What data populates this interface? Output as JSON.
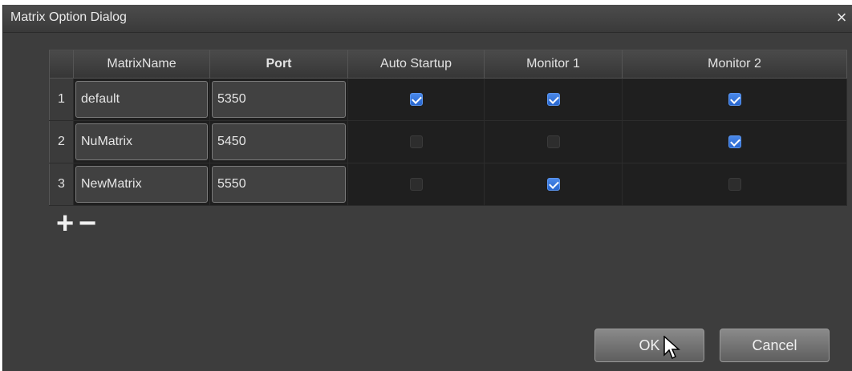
{
  "dialog": {
    "title": "Matrix Option Dialog",
    "close_glyph": "×"
  },
  "table": {
    "headers": [
      "MatrixName",
      "Port",
      "Auto Startup",
      "Monitor 1",
      "Monitor 2"
    ],
    "rows": [
      {
        "num": "1",
        "name": "default",
        "port": "5350",
        "auto_startup": true,
        "monitor1": true,
        "monitor2": true
      },
      {
        "num": "2",
        "name": "NuMatrix",
        "port": "5450",
        "auto_startup": false,
        "monitor1": false,
        "monitor2": true
      },
      {
        "num": "3",
        "name": "NewMatrix",
        "port": "5550",
        "auto_startup": false,
        "monitor1": true,
        "monitor2": false
      }
    ]
  },
  "controls": {
    "add_glyph": "+",
    "remove_glyph": "−"
  },
  "buttons": {
    "ok": "OK",
    "cancel": "Cancel"
  },
  "icons": {
    "close": "close-icon",
    "add": "plus-icon",
    "remove": "minus-icon",
    "cursor": "mouse-pointer-icon"
  },
  "colors": {
    "checkbox_on": "#2f6fd8",
    "background": "#3d3d3d",
    "grid_background": "#1f1f1f"
  }
}
